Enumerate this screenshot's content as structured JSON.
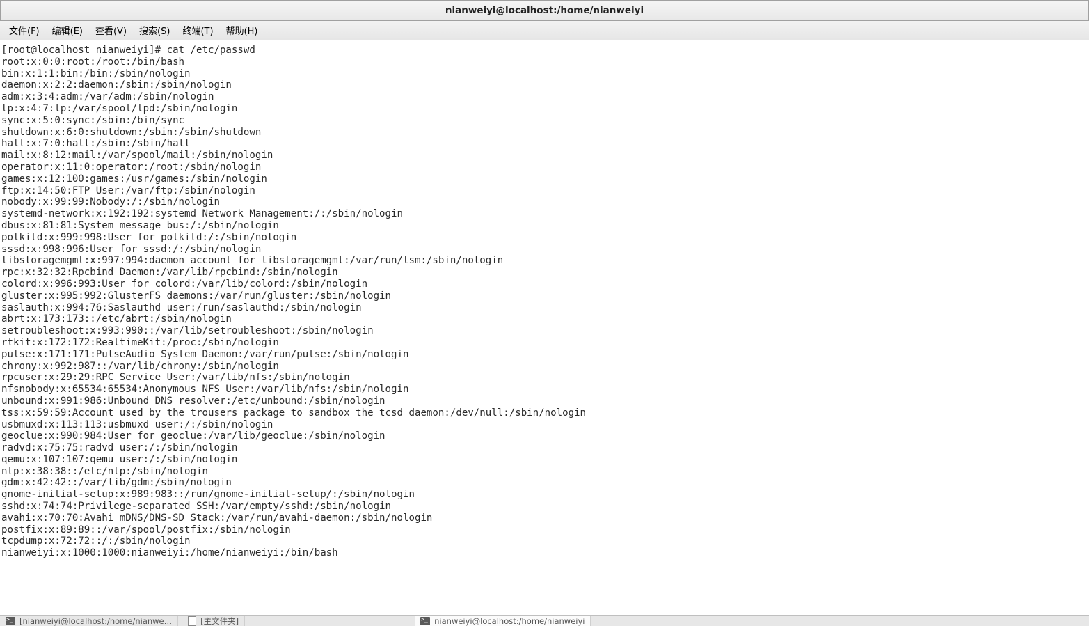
{
  "window": {
    "title": "nianweiyi@localhost:/home/nianweiyi"
  },
  "menu": {
    "file": "文件(F)",
    "edit": "编辑(E)",
    "view": "查看(V)",
    "search": "搜索(S)",
    "terminal": "终端(T)",
    "help": "帮助(H)"
  },
  "terminal": {
    "prompt": "[root@localhost nianweiyi]# cat /etc/passwd",
    "lines": [
      "root:x:0:0:root:/root:/bin/bash",
      "bin:x:1:1:bin:/bin:/sbin/nologin",
      "daemon:x:2:2:daemon:/sbin:/sbin/nologin",
      "adm:x:3:4:adm:/var/adm:/sbin/nologin",
      "lp:x:4:7:lp:/var/spool/lpd:/sbin/nologin",
      "sync:x:5:0:sync:/sbin:/bin/sync",
      "shutdown:x:6:0:shutdown:/sbin:/sbin/shutdown",
      "halt:x:7:0:halt:/sbin:/sbin/halt",
      "mail:x:8:12:mail:/var/spool/mail:/sbin/nologin",
      "operator:x:11:0:operator:/root:/sbin/nologin",
      "games:x:12:100:games:/usr/games:/sbin/nologin",
      "ftp:x:14:50:FTP User:/var/ftp:/sbin/nologin",
      "nobody:x:99:99:Nobody:/:/sbin/nologin",
      "systemd-network:x:192:192:systemd Network Management:/:/sbin/nologin",
      "dbus:x:81:81:System message bus:/:/sbin/nologin",
      "polkitd:x:999:998:User for polkitd:/:/sbin/nologin",
      "sssd:x:998:996:User for sssd:/:/sbin/nologin",
      "libstoragemgmt:x:997:994:daemon account for libstoragemgmt:/var/run/lsm:/sbin/nologin",
      "rpc:x:32:32:Rpcbind Daemon:/var/lib/rpcbind:/sbin/nologin",
      "colord:x:996:993:User for colord:/var/lib/colord:/sbin/nologin",
      "gluster:x:995:992:GlusterFS daemons:/var/run/gluster:/sbin/nologin",
      "saslauth:x:994:76:Saslauthd user:/run/saslauthd:/sbin/nologin",
      "abrt:x:173:173::/etc/abrt:/sbin/nologin",
      "setroubleshoot:x:993:990::/var/lib/setroubleshoot:/sbin/nologin",
      "rtkit:x:172:172:RealtimeKit:/proc:/sbin/nologin",
      "pulse:x:171:171:PulseAudio System Daemon:/var/run/pulse:/sbin/nologin",
      "chrony:x:992:987::/var/lib/chrony:/sbin/nologin",
      "rpcuser:x:29:29:RPC Service User:/var/lib/nfs:/sbin/nologin",
      "nfsnobody:x:65534:65534:Anonymous NFS User:/var/lib/nfs:/sbin/nologin",
      "unbound:x:991:986:Unbound DNS resolver:/etc/unbound:/sbin/nologin",
      "tss:x:59:59:Account used by the trousers package to sandbox the tcsd daemon:/dev/null:/sbin/nologin",
      "usbmuxd:x:113:113:usbmuxd user:/:/sbin/nologin",
      "geoclue:x:990:984:User for geoclue:/var/lib/geoclue:/sbin/nologin",
      "radvd:x:75:75:radvd user:/:/sbin/nologin",
      "qemu:x:107:107:qemu user:/:/sbin/nologin",
      "ntp:x:38:38::/etc/ntp:/sbin/nologin",
      "gdm:x:42:42::/var/lib/gdm:/sbin/nologin",
      "gnome-initial-setup:x:989:983::/run/gnome-initial-setup/:/sbin/nologin",
      "sshd:x:74:74:Privilege-separated SSH:/var/empty/sshd:/sbin/nologin",
      "avahi:x:70:70:Avahi mDNS/DNS-SD Stack:/var/run/avahi-daemon:/sbin/nologin",
      "postfix:x:89:89::/var/spool/postfix:/sbin/nologin",
      "tcpdump:x:72:72::/:/sbin/nologin",
      "nianweiyi:x:1000:1000:nianweiyi:/home/nianweiyi:/bin/bash"
    ]
  },
  "taskbar": {
    "task1": "[nianweiyi@localhost:/home/nianwe…",
    "task2": "[主文件夹]",
    "task3": "nianweiyi@localhost:/home/nianweiyi"
  }
}
